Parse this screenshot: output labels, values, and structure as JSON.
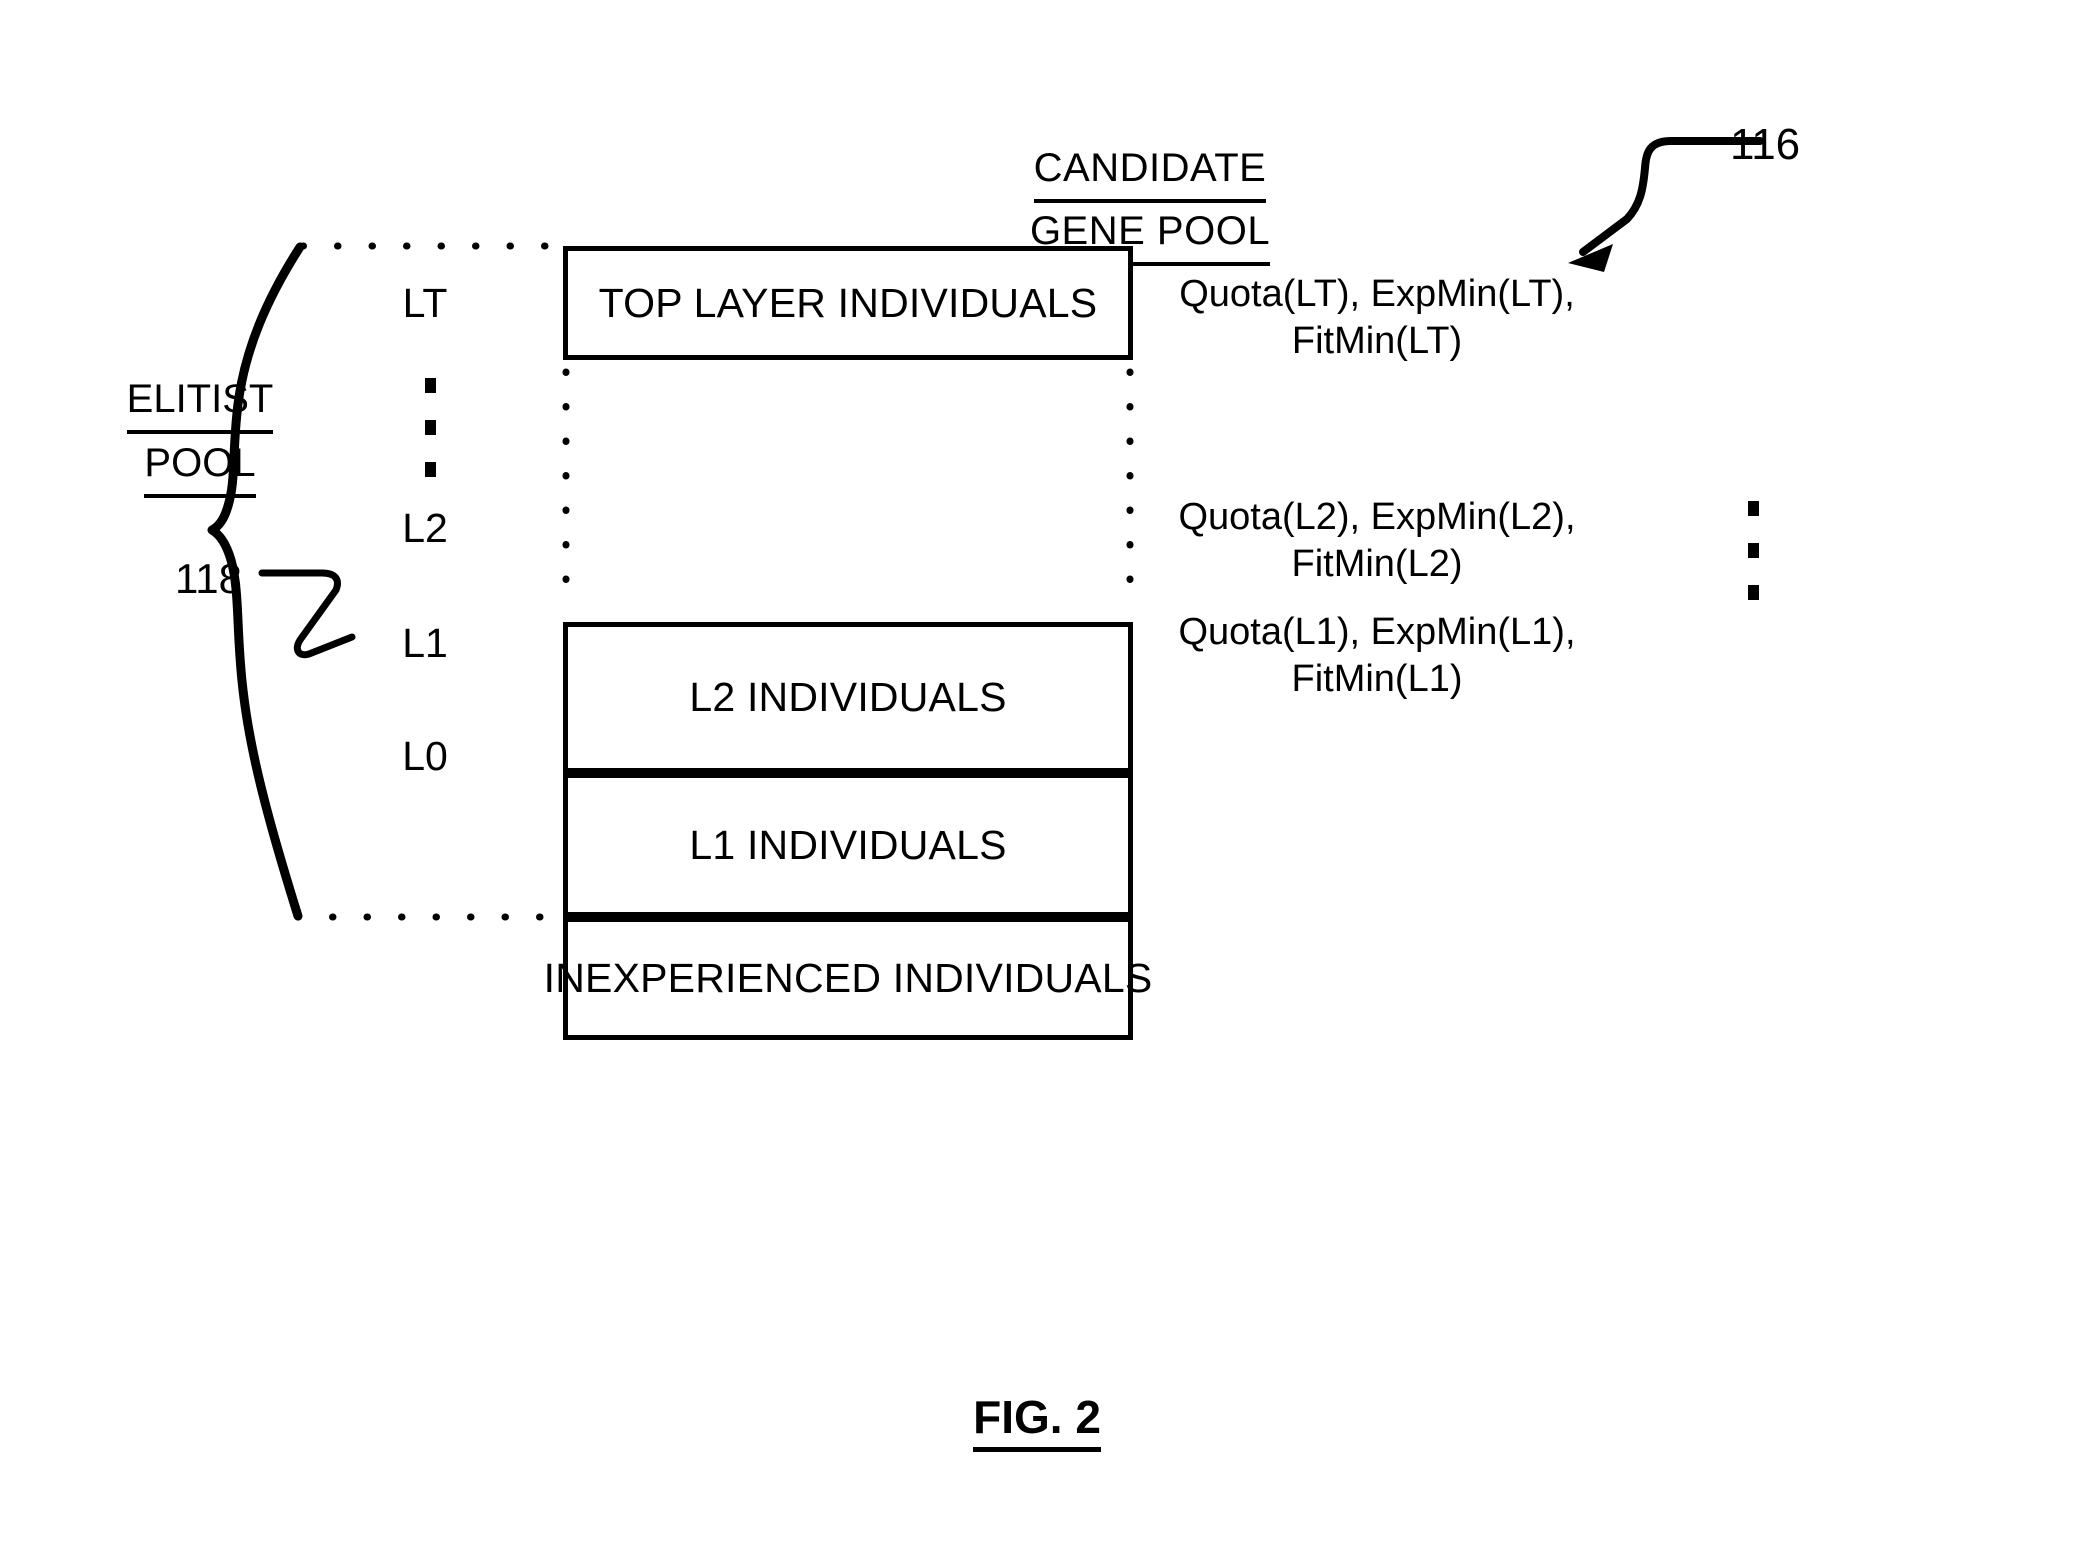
{
  "figure": {
    "caption": "FIG. 2",
    "title_lines": [
      "CANDIDATE",
      "GENE  POOL"
    ],
    "elitist_label_lines": [
      "ELITIST",
      "POOL"
    ],
    "reference_numerals": {
      "gene_pool": "116",
      "elitist_pool": "118"
    },
    "vertical_ellipsis": "⋮"
  },
  "layers": [
    {
      "name": "LT",
      "box_text": "TOP LAYER INDIVIDUALS",
      "annotation_lines": [
        "Quota(LT), ExpMin(LT),",
        "FitMin(LT)"
      ]
    },
    {
      "name": "L2",
      "box_text": "L2 INDIVIDUALS",
      "annotation_lines": [
        "Quota(L2), ExpMin(L2),",
        "FitMin(L2)"
      ]
    },
    {
      "name": "L1",
      "box_text": "L1 INDIVIDUALS",
      "annotation_lines": [
        "Quota(L1), ExpMin(L1),",
        "FitMin(L1)"
      ]
    },
    {
      "name": "L0",
      "box_text": "INEXPERIENCED INDIVIDUALS",
      "annotation_lines": []
    }
  ],
  "colors": {
    "ink": "#000000",
    "paper": "#ffffff"
  }
}
